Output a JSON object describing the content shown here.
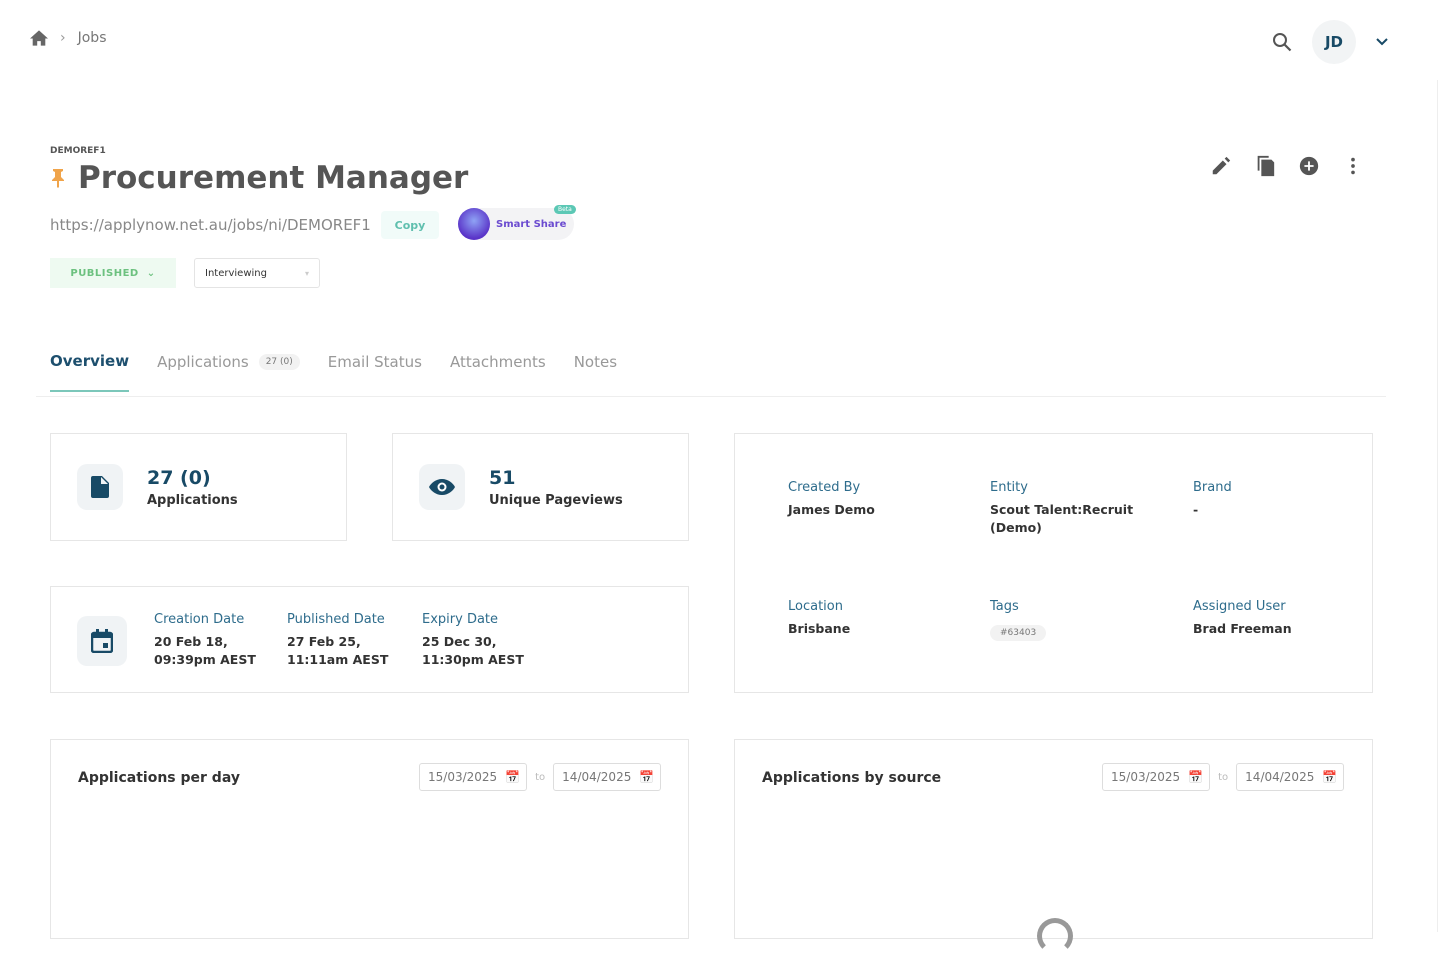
{
  "breadcrumb": {
    "current": "Jobs"
  },
  "user": {
    "initials": "JD"
  },
  "job": {
    "ref": "DEMOREF1",
    "title": "Procurement Manager",
    "url": "https://applynow.net.au/jobs/ni/DEMOREF1",
    "copy_label": "Copy",
    "smart_share_label": "Smart Share",
    "beta_label": "Beta",
    "status": "PUBLISHED",
    "stage": "Interviewing"
  },
  "tabs": [
    {
      "label": "Overview"
    },
    {
      "label": "Applications",
      "badge": "27 (0)"
    },
    {
      "label": "Email Status"
    },
    {
      "label": "Attachments"
    },
    {
      "label": "Notes"
    }
  ],
  "stats": {
    "applications_value": "27 (0)",
    "applications_label": "Applications",
    "pageviews_value": "51",
    "pageviews_label": "Unique Pageviews"
  },
  "dates": [
    {
      "label": "Creation Date",
      "line1": "20 Feb 18,",
      "line2": "09:39pm AEST"
    },
    {
      "label": "Published Date",
      "line1": "27 Feb 25,",
      "line2": "11:11am AEST"
    },
    {
      "label": "Expiry Date",
      "line1": "25 Dec 30,",
      "line2": "11:30pm AEST"
    }
  ],
  "details": {
    "created_by_label": "Created By",
    "created_by": "James Demo",
    "entity_label": "Entity",
    "entity": "Scout Talent:Recruit (Demo)",
    "brand_label": "Brand",
    "brand": "-",
    "location_label": "Location",
    "location": "Brisbane",
    "tags_label": "Tags",
    "tag": "#63403",
    "assigned_label": "Assigned User",
    "assigned": "Brad Freeman"
  },
  "charts": [
    {
      "title": "Applications per day",
      "from": "15/03/2025",
      "to_label": "to",
      "to": "14/04/2025"
    },
    {
      "title": "Applications by source",
      "from": "15/03/2025",
      "to_label": "to",
      "to": "14/04/2025"
    }
  ]
}
